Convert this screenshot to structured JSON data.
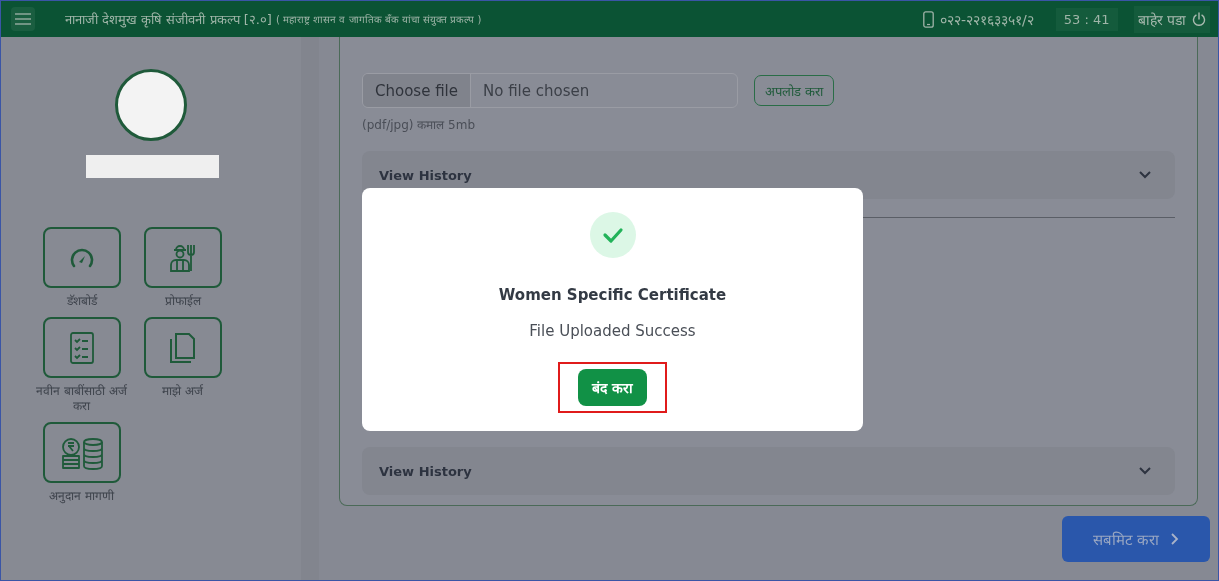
{
  "header": {
    "title": "नानाजी देशमुख कृषि संजीवनी प्रकल्प [२.०]",
    "subtitle": "( महाराष्ट्र शासन व जागतिक बँक यांचा संयुक्त प्रकल्प )",
    "phone": "०२२-२२१६३३५१/२",
    "timer": "53 : 41",
    "logout": "बाहेर पडा"
  },
  "sidebar": {
    "menu": [
      {
        "kind": "dashboard",
        "label": "डॅशबोर्ड"
      },
      {
        "kind": "profile",
        "label": "प्रोफाईल"
      },
      {
        "kind": "checklist",
        "label": "नवीन बाबींसाठी अर्ज करा"
      },
      {
        "kind": "documents",
        "label": "माझे अर्ज"
      },
      {
        "kind": "coins",
        "label": "अनुदान मागणी"
      }
    ]
  },
  "upload": {
    "choose_button": "Choose file",
    "file_value": "No file chosen",
    "upload_button": "अपलोड करा",
    "hint": "(pdf/jpg) कमाल 5mb"
  },
  "accordions": [
    {
      "label": "View History"
    },
    {
      "label": "View History"
    }
  ],
  "submit_button": "सबमिट करा",
  "dialog": {
    "title": "Women Specific Certificate",
    "message": "File Uploaded Success",
    "close_button": "बंद करा"
  }
}
